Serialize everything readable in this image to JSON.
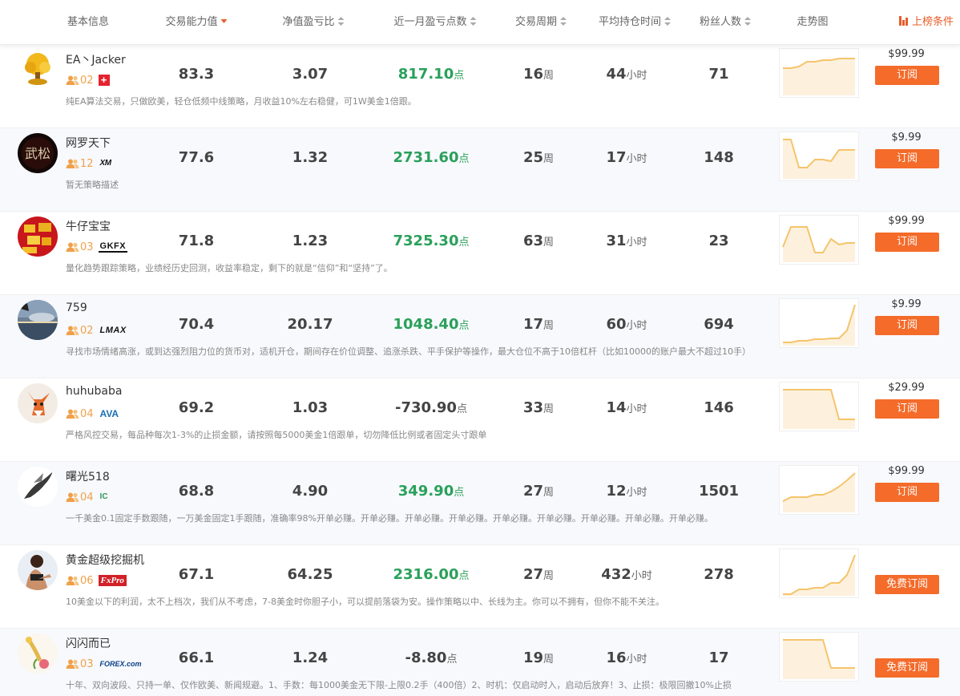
{
  "header": {
    "basic_info": "基本信息",
    "trade_ability": "交易能力值",
    "net_profit_ratio": "净值盈亏比",
    "month_points": "近一月盈亏点数",
    "trade_period": "交易周期",
    "avg_hold": "平均持仓时间",
    "fans": "粉丝人数",
    "trend": "走势图",
    "ranking_condition": "上榜条件"
  },
  "units": {
    "points": "点",
    "weeks": "周",
    "hours": "小时"
  },
  "colors": {
    "accent": "#f46b2a",
    "profit": "#2aa05a",
    "fans": "#f0a04a",
    "chart_line": "#f5c46b"
  },
  "rows": [
    {
      "name": "EA丶Jacker",
      "fans_badge": "02",
      "broker": "swiss",
      "broker_label": "+",
      "ability": "83.3",
      "ratio": "3.07",
      "points": "817.10",
      "points_positive": true,
      "period": "16",
      "hold": "44",
      "fans": "71",
      "price": "$99.99",
      "button": "订阅",
      "free": false,
      "desc": "纯EA算法交易，只做欧美，轻仓低频中线策略，月收益10%左右稳健，可1W美金1倍跟。",
      "avatar": "money-tree",
      "trend": [
        20,
        20,
        18,
        12,
        12,
        10,
        10,
        8,
        8,
        8
      ]
    },
    {
      "name": "网罗天下",
      "fans_badge": "12",
      "broker": "xm",
      "broker_label": "XM",
      "ability": "77.6",
      "ratio": "1.32",
      "points": "2731.60",
      "points_positive": true,
      "period": "25",
      "hold": "17",
      "fans": "148",
      "price": "$9.99",
      "button": "订阅",
      "free": false,
      "desc": "暂无策略描述",
      "avatar": "wusong",
      "trend": [
        5,
        5,
        40,
        40,
        30,
        30,
        32,
        18,
        18,
        18
      ]
    },
    {
      "name": "牛仔宝宝",
      "fans_badge": "03",
      "broker": "gkfx",
      "broker_label": "GKFX",
      "ability": "71.8",
      "ratio": "1.23",
      "points": "7325.30",
      "points_positive": true,
      "period": "63",
      "hold": "31",
      "fans": "23",
      "price": "$99.99",
      "button": "订阅",
      "free": false,
      "desc": "量化趋势跟踪策略，业绩经历史回测，收益率稳定，剩下的就是“信仰”和“坚持”了。",
      "avatar": "gold-bars",
      "trend": [
        35,
        10,
        10,
        10,
        42,
        42,
        25,
        32,
        30,
        30
      ]
    },
    {
      "name": "759",
      "fans_badge": "02",
      "broker": "lmax",
      "broker_label": "LMAX",
      "ability": "70.4",
      "ratio": "20.17",
      "points": "1048.40",
      "points_positive": true,
      "period": "17",
      "hold": "60",
      "fans": "694",
      "price": "$9.99",
      "button": "订阅",
      "free": false,
      "desc": "寻找市场情绪高涨，或到达强烈阻力位的货币对，适机开仓，期间存在价位调整、追涨杀跌、平手保护等操作，最大仓位不高于10倍杠杆（比如10000的账户最大不超过10手）",
      "avatar": "sunset",
      "trend": [
        50,
        50,
        48,
        48,
        46,
        46,
        45,
        45,
        35,
        3
      ]
    },
    {
      "name": "huhubaba",
      "fans_badge": "04",
      "broker": "ava",
      "broker_label": "AVA",
      "ability": "69.2",
      "ratio": "1.03",
      "points": "-730.90",
      "points_positive": false,
      "period": "33",
      "hold": "14",
      "fans": "146",
      "price": "$29.99",
      "button": "订阅",
      "free": false,
      "desc": "严格风控交易，每品种每次1-3%的止损金额，请按照每5000美金1倍跟单，切勿降低比例或者固定头寸跟单",
      "avatar": "fox",
      "trend": [
        5,
        5,
        5,
        5,
        5,
        5,
        5,
        42,
        42,
        42
      ]
    },
    {
      "name": "曙光518",
      "fans_badge": "04",
      "broker": "ic",
      "broker_label": "IC",
      "ability": "68.8",
      "ratio": "4.90",
      "points": "349.90",
      "points_positive": true,
      "period": "27",
      "hold": "12",
      "fans": "1501",
      "price": "$99.99",
      "button": "订阅",
      "free": false,
      "desc": "一千美金0.1固定手数跟随，一万美金固定1手跟随，准确率98%开单必赚。开单必赚。开单必赚。开单必赚。开单必赚。开单必赚。开单必赚。开单必赚。开单必赚。",
      "avatar": "bird",
      "trend": [
        40,
        35,
        35,
        35,
        32,
        32,
        28,
        22,
        14,
        5
      ]
    },
    {
      "name": "黄金超级挖掘机",
      "fans_badge": "06",
      "broker": "fxpro",
      "broker_label": "FxPro",
      "ability": "67.1",
      "ratio": "64.25",
      "points": "2316.00",
      "points_positive": true,
      "period": "27",
      "hold": "432",
      "fans": "278",
      "price": "",
      "button": "免费订阅",
      "free": true,
      "desc": "10美金以下的利润，太不上档次，我们从不考虑，7-8美金时你胆子小，可以提前落袋为安。操作策略以中、长线为主。你可以不拥有，但你不能不关注。",
      "avatar": "woman",
      "trend": [
        52,
        52,
        46,
        46,
        44,
        44,
        38,
        38,
        28,
        3
      ]
    },
    {
      "name": "闪闪而已",
      "fans_badge": "03",
      "broker": "forex",
      "broker_label": "FOREX.com",
      "ability": "66.1",
      "ratio": "1.24",
      "points": "-8.80",
      "points_positive": false,
      "period": "19",
      "hold": "16",
      "fans": "17",
      "price": "",
      "button": "免费订阅",
      "free": true,
      "desc": "十年、双向波段、只持一单、仅作欧美、新闻规避。1、手数：每1000美金无下限-上限0.2手（400倍）2、时机：仅启动时入，启动后放弃！3、止损：极限回撤10%止损",
      "avatar": "flower",
      "trend": [
        5,
        5,
        5,
        5,
        5,
        5,
        40,
        40,
        40,
        40
      ]
    }
  ]
}
